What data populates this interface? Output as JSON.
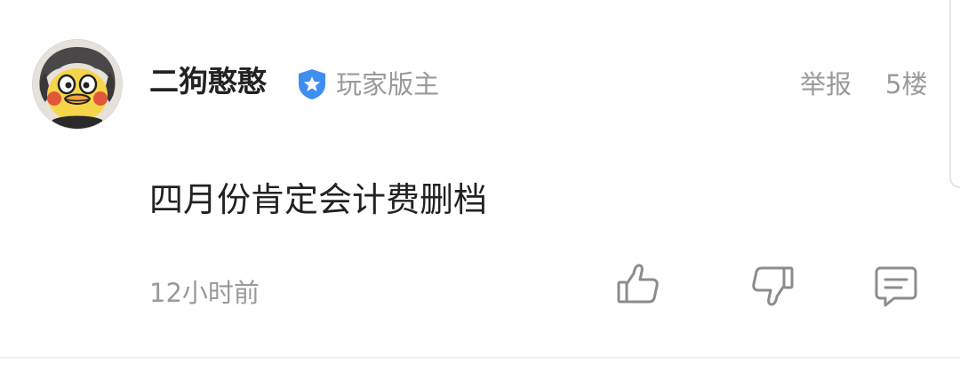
{
  "comment": {
    "user": {
      "name": "二狗憨憨",
      "badge": "玩家版主",
      "avatar_icon": "duck-cartoon-avatar"
    },
    "actions_top": {
      "report": "举报",
      "floor": "5楼"
    },
    "text": "四月份肯定会计费删档",
    "time": "12小时前",
    "icons": {
      "badge": "shield-star-icon",
      "like": "thumbs-up-icon",
      "dislike": "thumbs-down-icon",
      "reply": "comment-icon"
    },
    "colors": {
      "badge_blue": "#3d8ef0",
      "muted_text": "#9a9a9a",
      "primary_text": "#222222",
      "icon_gray": "#8c8c8c"
    }
  }
}
